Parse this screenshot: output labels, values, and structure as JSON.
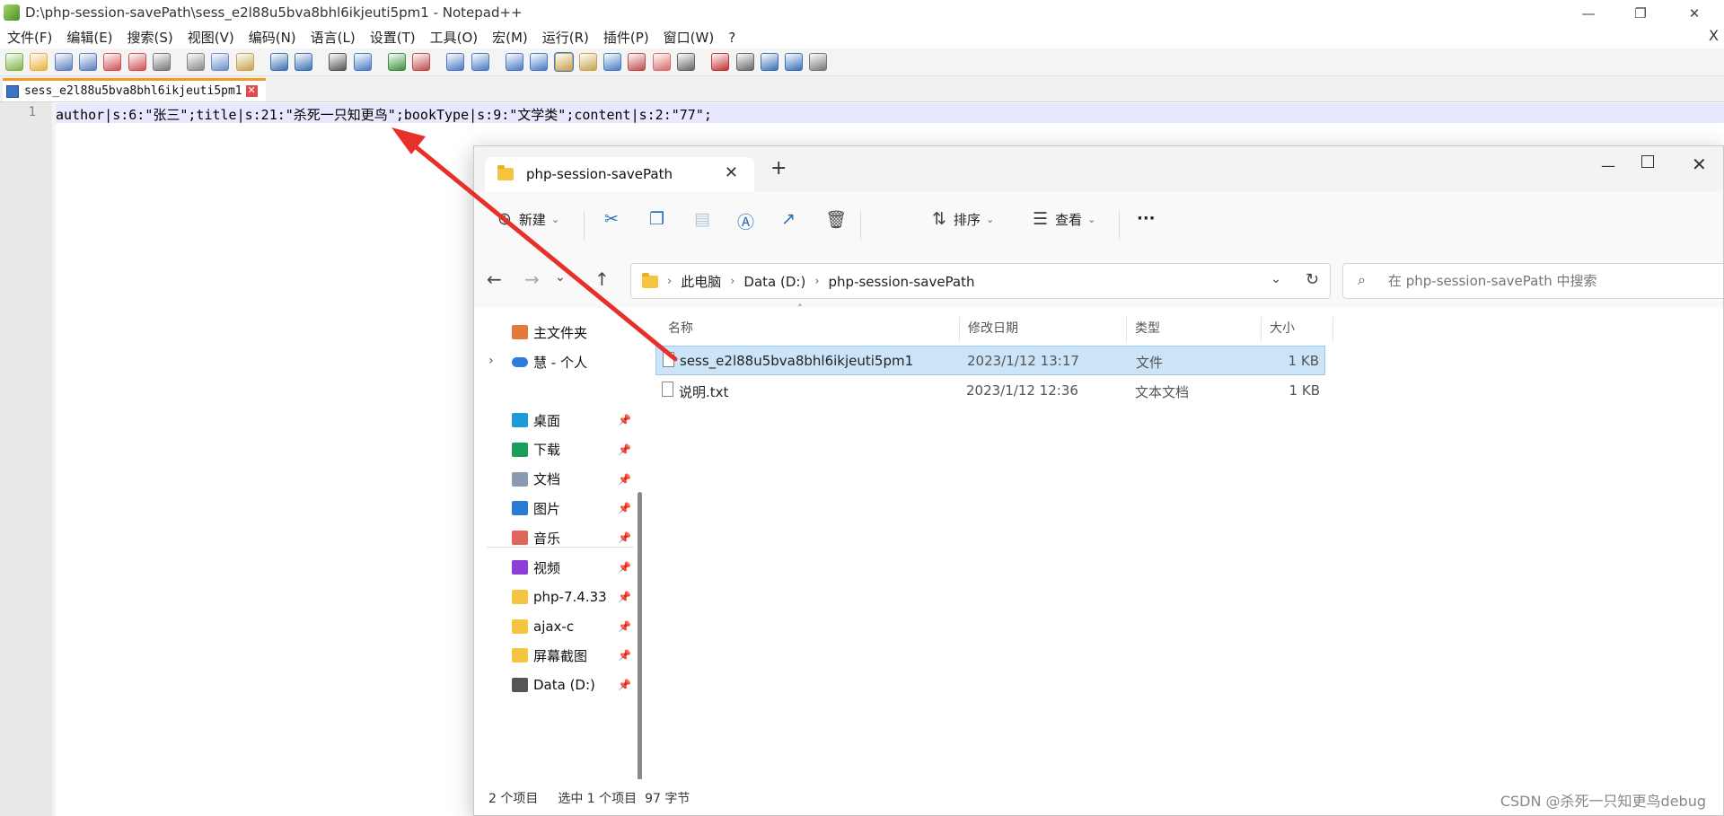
{
  "notepad": {
    "title": "D:\\php-session-savePath\\sess_e2l88u5bva8bhl6ikjeuti5pm1 - Notepad++",
    "window_controls": {
      "minimize": "—",
      "restore": "❐",
      "close": "✕"
    },
    "menu": [
      "文件(F)",
      "编辑(E)",
      "搜索(S)",
      "视图(V)",
      "编码(N)",
      "语言(L)",
      "设置(T)",
      "工具(O)",
      "宏(M)",
      "运行(R)",
      "插件(P)",
      "窗口(W)",
      "?"
    ],
    "menu_close": "X",
    "tab": {
      "label": "sess_e2l88u5bva8bhl6ikjeuti5pm1",
      "close": "✕"
    },
    "editor": {
      "line_number": "1",
      "code": "author|s:6:\"张三\";title|s:21:\"杀死一只知更鸟\";bookType|s:9:\"文学类\";content|s:2:\"77\";"
    },
    "toolbar_icons": [
      "new-icon",
      "open-icon",
      "save-icon",
      "save-all-icon",
      "close-icon",
      "close-all-icon",
      "print-icon",
      "cut-icon",
      "copy-icon",
      "paste-icon",
      "undo-icon",
      "redo-icon",
      "find-icon",
      "replace-icon",
      "zoom-in-icon",
      "zoom-out-icon",
      "sync-v-icon",
      "sync-h-icon",
      "word-wrap-icon",
      "show-all-chars-icon",
      "indent-guide-icon",
      "udl-icon",
      "doc-map-icon",
      "function-list-icon",
      "folder-workspace-icon",
      "monitor-icon",
      "record-macro-icon",
      "stop-macro-icon",
      "play-macro-icon",
      "run-macro-multiple-icon",
      "save-macro-icon"
    ],
    "toolbar_colors": [
      "#7fb24a",
      "#e8b23a",
      "#5a7fbf",
      "#5a7fbf",
      "#d05050",
      "#d05050",
      "#777777",
      "#888888",
      "#6a8fc9",
      "#c9a24a",
      "#3b6fb5",
      "#3b6fb5",
      "#555555",
      "#4a79c4",
      "#3a8f3a",
      "#c04a4a",
      "#4a79c4",
      "#4a79c4",
      "#4a79c4",
      "#4a79c4",
      "#c9a24a",
      "#c9a24a",
      "#4a79c4",
      "#c04a4a",
      "#d86b6b",
      "#666666",
      "#c03030",
      "#666666",
      "#3a6fb5",
      "#3a6fb5",
      "#777777"
    ]
  },
  "explorer": {
    "tab_title": "php-session-savePath",
    "tab_close": "✕",
    "new_tab": "+",
    "window_controls": {
      "minimize": "—",
      "close": "✕"
    },
    "commands": {
      "new": "新建",
      "sort": "排序",
      "view": "查看",
      "more": "···"
    },
    "nav_buttons": {
      "back": "←",
      "forward": "→",
      "recent": "⌄",
      "up": "↑"
    },
    "address": [
      "此电脑",
      "Data (D:)",
      "php-session-savePath"
    ],
    "address_sep": "›",
    "search_placeholder": "在 php-session-savePath 中搜索",
    "nav_pane": {
      "top": [
        {
          "label": "主文件夹",
          "icon": "home-icon"
        },
        {
          "label": "慧 - 个人",
          "icon": "onedrive-icon"
        }
      ],
      "pinned": [
        {
          "label": "桌面",
          "icon": "desktop-icon",
          "color": "#1e9bd7"
        },
        {
          "label": "下载",
          "icon": "download-icon",
          "color": "#1a9e5a"
        },
        {
          "label": "文档",
          "icon": "documents-icon",
          "color": "#8a9bb0"
        },
        {
          "label": "图片",
          "icon": "pictures-icon",
          "color": "#2b7bd6"
        },
        {
          "label": "音乐",
          "icon": "music-icon",
          "color": "#e0665a"
        },
        {
          "label": "视频",
          "icon": "videos-icon",
          "color": "#8b3fd6"
        },
        {
          "label": "php-7.4.33",
          "icon": "folder-icon",
          "color": "#f5c542"
        },
        {
          "label": "ajax-c",
          "icon": "folder-icon",
          "color": "#f5c542"
        },
        {
          "label": "屏幕截图",
          "icon": "folder-icon",
          "color": "#f5c542"
        },
        {
          "label": "Data (D:)",
          "icon": "drive-icon",
          "color": "#555555"
        }
      ],
      "pin_glyph": "📌"
    },
    "columns": [
      "名称",
      "修改日期",
      "类型",
      "大小"
    ],
    "files": [
      {
        "name": "sess_e2l88u5bva8bhl6ikjeuti5pm1",
        "date": "2023/1/12 13:17",
        "type": "文件",
        "size": "1 KB",
        "selected": true
      },
      {
        "name": "说明.txt",
        "date": "2023/1/12 12:36",
        "type": "文本文档",
        "size": "1 KB",
        "selected": false
      }
    ],
    "status": {
      "count": "2 个项目",
      "selection": "选中 1 个项目  97 字节"
    }
  },
  "watermark": "CSDN @杀死一只知更鸟debug",
  "arrow_color": "#e8302a"
}
